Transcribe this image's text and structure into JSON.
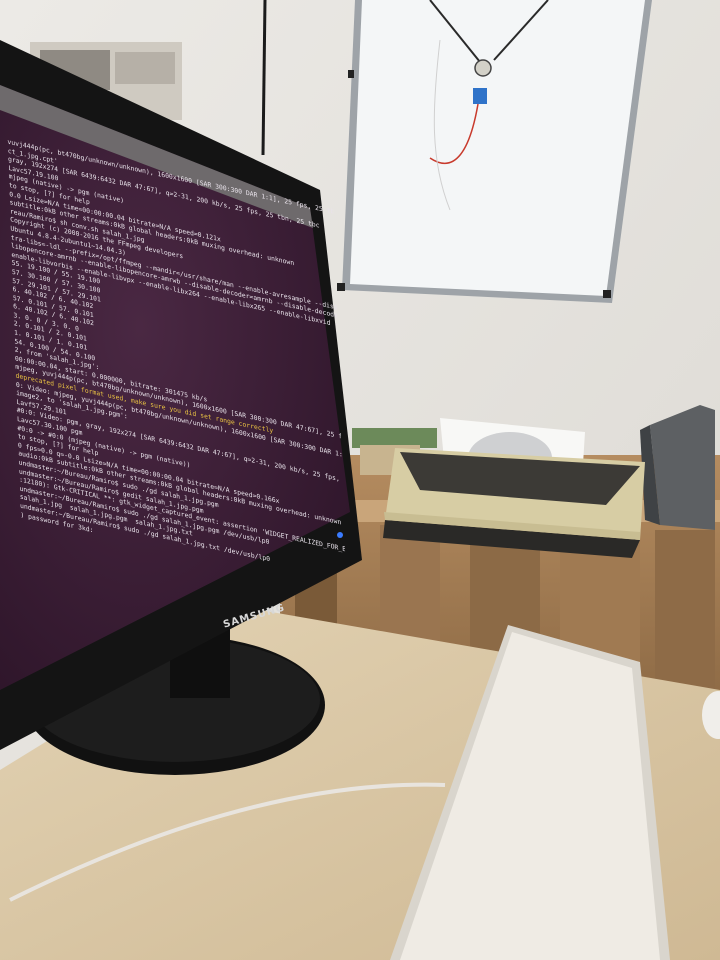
{
  "scene": {
    "description_label": "",
    "monitor": {
      "brand": "SAMSUNG",
      "terminal_lines": [
        "vuvj444p(pc, bt470bg/unknown/unknown), 1600x1600 [SAR 300:300 DAR 1:1], 25 fps, 25 tbr,",
        "ct_1.jpg.cpt'",
        "gray, 192x274 [SAR 6439:6432 DAR 47:67], q=2-31, 200 kb/s, 25 fps, 25 tbn, 25 tbc",
        "Lavc57.19.100",
        "mjpeg (native) -> pgm (native)",
        "to stop, [?] for help",
        "0.0 Lsize=N/A time=00:00:00.04 bitrate=N/A speed=0.121x",
        "subtitle:0kB other streams:0kB global headers:0kB muxing overhead: unknown",
        "reau/Ramiro$ sh conv.sh salah_1.jpg",
        "Copyright (c) 2000-2016 the FFmpeg developers",
        "Ubuntu 4.8.4-2ubuntu1~14.04.3)",
        "tra-libs=-ldl --prefix=/opt/ffmpeg --mandir=/usr/share/man --enable-avresample --disable-debug",
        "libopencore-amrnb --enable-libopencore-amrwb --disable-decoder=amrnb --disable-decoder=amrwb",
        "enable-libvorbis --enable-libvpx --enable-libx264 --enable-libx265 --enable-libxvid --enable-gpl",
        "55. 19.100 / 55. 19.100",
        "57. 30.100 / 57. 30.100",
        "57. 29.101 / 57. 29.101",
        "6. 40.102 / 6. 40.102",
        "57. 0.101 / 57. 0.101",
        "6. 40.102 / 6. 40.102",
        "3. 0. 0 / 3. 0. 0",
        "2. 0.101 / 2. 0.101",
        "1. 0.101 / 1. 0.101",
        "54. 0.100 / 54. 0.100",
        "2, from 'salah_1.jpg':",
        "00:00:00.04, start: 0.000000, bitrate: 301475 kb/s",
        "mjpeg, yuvj444p(pc, bt470bg/unknown/unknown), 1600x1600 [SAR 300:300 DAR 47:67], 25 fps, 25 tbr",
        "deprecated pixel format used, make sure you did set range correctly",
        "0: Video: mjpeg, yuvj444p(pc, bt470bg/unknown/unknown), 1600x1600 [SAR 300:300 DAR 1:1], 25 fps",
        "image2, to 'salah_1.jpg.pgm':",
        "Lavf57.29.101",
        "#0:0: Video: pgm, gray, 192x274 [SAR 6439:6432 DAR 47:67], q=2-31, 200 kb/s, 25 fps, 25 tbn",
        "Lavc57.30.100 pgm",
        "#0:0 -> #0:0 (mjpeg (native) -> pgm (native))",
        "to stop, [?] for help",
        "0 fps=0.0 q=-0.0 Lsize=N/A time=00:00:00.04 bitrate=N/A speed=0.166x",
        "audio:0kB subtitle:0kB other streams:0kB global headers:0kB muxing overhead: unknown",
        "undmaster:~/Bureau/Ramiro$ sudo ./gd salah_1.jpg.pgm",
        "undmaster:~/Bureau/Ramiro$ gedit salah_1.jpg.pgm",
        ":12180): Gtk-CRITICAL **: gtk_widget_captured_event: assertion 'WIDGET_REALIZED_FOR_EVENT' failed",
        "undmaster:~/Bureau/Ramiro$ sudo ./gd salah_1.jpg.pgm /dev/usb/lp0",
        "salah_1.jpg  salah_1.jpg.pgm  salah_1.jpg.txt",
        "undmaster:~/Bureau/Ramiro$ sudo ./gd salah_1.jpg.txt /dev/usb/lp0",
        ") password for 3kd:"
      ]
    },
    "colors": {
      "wall": "#e3e1dc",
      "terminal_bg": "#3a1d34",
      "desk": "#d9c7a6",
      "printer": "#d6cba2",
      "pallet": "#a9825a",
      "keyboard": "#eeeae2"
    }
  }
}
